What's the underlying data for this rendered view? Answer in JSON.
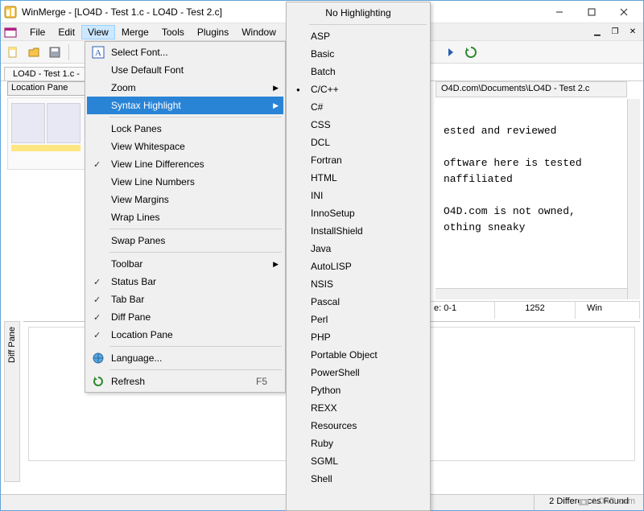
{
  "titlebar": {
    "title": "WinMerge - [LO4D - Test 1.c - LO4D - Test 2.c]"
  },
  "menubar": {
    "items": [
      "File",
      "Edit",
      "View",
      "Merge",
      "Tools",
      "Plugins",
      "Window"
    ],
    "active_index": 2
  },
  "doctab": {
    "label": "LO4D - Test 1.c -"
  },
  "location_pane": {
    "title": "Location Pane"
  },
  "paths": {
    "left": "",
    "right": "O4D.com\\Documents\\LO4D - Test 2.c"
  },
  "doc_text_right": "ested and reviewed\n\noftware here is tested\nnaffiliated\n\nO4D.com is not owned,\nothing sneaky",
  "doc_status": {
    "lnsel": "e: 0-1",
    "codepage": "1252",
    "os": "Win"
  },
  "diff_pane": {
    "label": "Diff Pane"
  },
  "statusbar": {
    "left": "",
    "right": "2 Differences Found"
  },
  "view_menu": {
    "items": [
      {
        "label": "Select Font...",
        "icon": "font-icon"
      },
      {
        "label": "Use Default Font"
      },
      {
        "label": "Zoom",
        "submenu": true
      },
      {
        "label": "Syntax Highlight",
        "submenu": true,
        "selected": true
      },
      {
        "sep": true
      },
      {
        "label": "Lock Panes"
      },
      {
        "label": "View Whitespace"
      },
      {
        "label": "View Line Differences",
        "checked": true
      },
      {
        "label": "View Line Numbers"
      },
      {
        "label": "View Margins"
      },
      {
        "label": "Wrap Lines"
      },
      {
        "sep": true
      },
      {
        "label": "Swap Panes"
      },
      {
        "sep": true
      },
      {
        "label": "Toolbar",
        "submenu": true
      },
      {
        "label": "Status Bar",
        "checked": true
      },
      {
        "label": "Tab Bar",
        "checked": true
      },
      {
        "label": "Diff Pane",
        "checked": true
      },
      {
        "label": "Location Pane",
        "checked": true
      },
      {
        "sep": true
      },
      {
        "label": "Language...",
        "icon": "globe-icon"
      },
      {
        "sep": true
      },
      {
        "label": "Refresh",
        "icon": "refresh-icon",
        "shortcut": "F5"
      }
    ]
  },
  "syntax_menu": {
    "top_item": "No Highlighting",
    "items": [
      "ASP",
      "Basic",
      "Batch",
      "C/C++",
      "C#",
      "CSS",
      "DCL",
      "Fortran",
      "HTML",
      "INI",
      "InnoSetup",
      "InstallShield",
      "Java",
      "AutoLISP",
      "NSIS",
      "Pascal",
      "Perl",
      "PHP",
      "Portable Object",
      "PowerShell",
      "Python",
      "REXX",
      "Resources",
      "Ruby",
      "SGML",
      "Shell"
    ],
    "selected_index": 3
  },
  "watermark": "LO4D.com"
}
